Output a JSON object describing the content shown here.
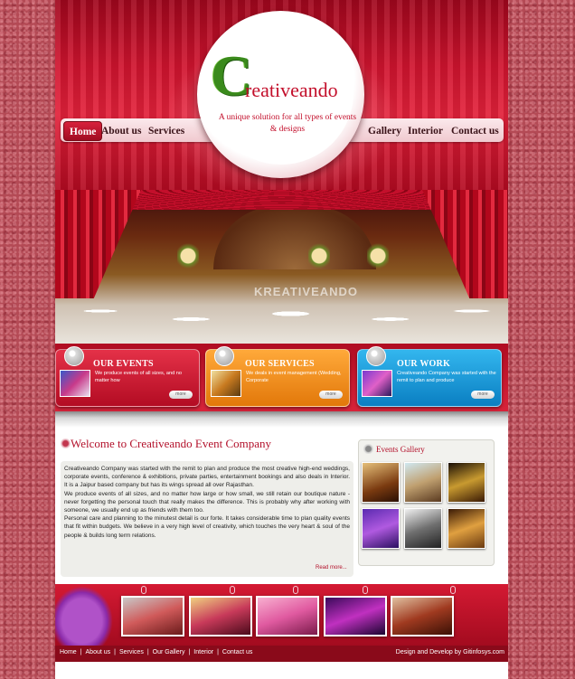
{
  "nav": {
    "left": [
      "Home",
      "About us",
      "Services"
    ],
    "right": [
      "Gallery",
      "Interior",
      "Contact us"
    ],
    "active": "Home"
  },
  "logo": {
    "initial": "C",
    "name": "reativeando",
    "tagline": "A unique solution for all types of events & designs"
  },
  "hero": {
    "watermark": "KREATIVEANDO"
  },
  "features": [
    {
      "title": "OUR EVENTS",
      "text": "We produce events of all sizes, and no matter how",
      "more": "more"
    },
    {
      "title": "OUR SERVICES",
      "text": "We deals in event management (Wedding, Corporate",
      "more": "more"
    },
    {
      "title": "OUR WORK",
      "text": "Creativeando Company was started with the remit to plan and produce",
      "more": "more"
    }
  ],
  "welcome": {
    "title": "Welcome to Creativeando Event Company",
    "paragraphs": [
      "Creativeando Company was started with the remit to plan and produce the most creative high-end weddings, corporate events, conference & exhibitions, private parties, entertainment bookings and also deals in Interior. It is a Jaipur based company but has its wings spread all over Rajasthan.",
      "We produce events of all sizes, and no matter how large or how small, we still retain our boutique nature - never forgetting the personal touch that really makes the difference. This is probably why after working with someone, we usually end up as friends with them too.",
      "Personal care and planning to the minutest detail is our forte. It takes considerable time to plan quality events that fit within budgets. We believe in a very high level of creativity, which touches the very heart & soul of the people & builds long term relations."
    ],
    "read_more": "Read more..."
  },
  "gallery": {
    "title": "Events Gallery"
  },
  "footer": {
    "links": [
      "Home",
      "About us",
      "Services",
      "Our Gallery",
      "Interior",
      "Contact us"
    ],
    "separator": "|",
    "credit": "Design and Develop by Gitinfosys.com"
  },
  "colors": {
    "brand_red": "#c30f2b",
    "logo_green": "#3a8a1c",
    "events_box": "#d41a33",
    "services_box": "#f08a1a",
    "work_box": "#1a9ad8"
  }
}
